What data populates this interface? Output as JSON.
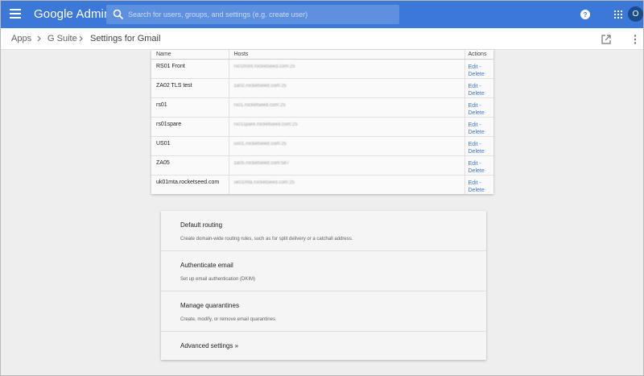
{
  "appbar": {
    "brand": "Google Admin",
    "search_placeholder": "Search for users, groups, and settings (e.g. create user)",
    "avatar_initial": "O",
    "icons": [
      "menu-icon",
      "search-icon",
      "help-icon",
      "apps-grid-icon"
    ],
    "color": "#3c78d8"
  },
  "breadcrumb": {
    "items": [
      "Apps",
      "G Suite",
      "Settings for Gmail"
    ]
  },
  "hosts_table": {
    "columns": [
      "Name",
      "Hosts",
      "Actions"
    ],
    "edit_label": "Edit -",
    "delete_label": "Delete",
    "rows": [
      {
        "name": "RS01 Front",
        "host": "rs01front.rocketseed.com:25"
      },
      {
        "name": "ZA02 TLS test",
        "host": "za02.rocketseed.com:25"
      },
      {
        "name": "rs01",
        "host": "rs01.rocketseed.com:25"
      },
      {
        "name": "rs01spare",
        "host": "rs01spare.rocketseed.com:25"
      },
      {
        "name": "US01",
        "host": "us01.rocketseed.com:25"
      },
      {
        "name": "ZA05",
        "host": "za05.rocketseed.com:587"
      },
      {
        "name": "uk01mta.rocketseed.com",
        "host": "uk01mta.rocketseed.com:25"
      }
    ]
  },
  "settings": [
    {
      "title": "Default routing",
      "desc": "Create domain-wide routing rules, such as for split delivery or a catchall address."
    },
    {
      "title": "Authenticate email",
      "desc": "Set up email authentication (DKIM)"
    },
    {
      "title": "Manage quarantines",
      "desc": "Create, modify, or remove email quarantines"
    },
    {
      "title": "Advanced settings »",
      "desc": ""
    }
  ]
}
